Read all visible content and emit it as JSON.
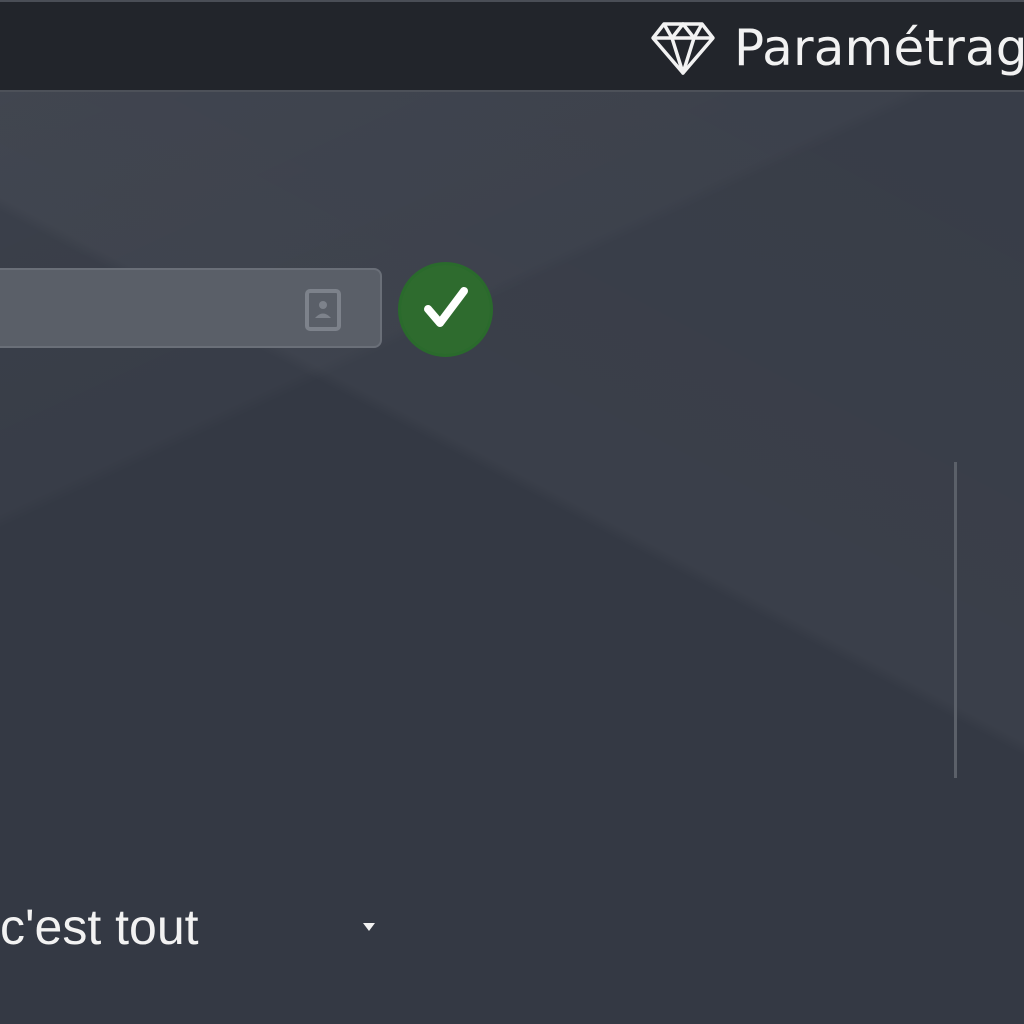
{
  "header": {
    "title": "Paramétrag",
    "icon": "diamond-icon"
  },
  "form": {
    "field_value": "",
    "field_icon": "contact-card-icon",
    "confirm_icon": "checkmark-icon",
    "confirm_color": "#2e6b2e"
  },
  "selector": {
    "selected": "c'est tout",
    "icon": "caret-down-icon"
  },
  "colors": {
    "background": "#343944",
    "topbar": "#22252b",
    "field": "#5a5f68"
  }
}
